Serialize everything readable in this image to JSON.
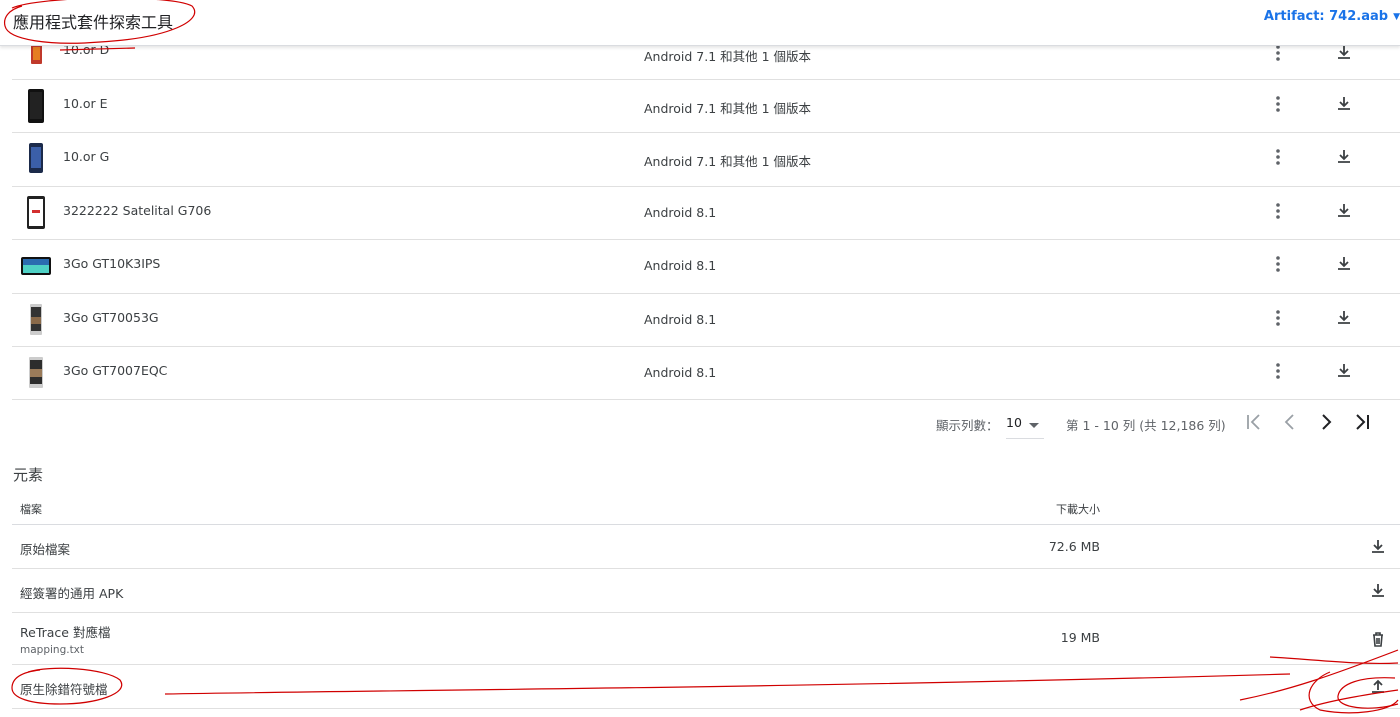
{
  "header": {
    "title": "應用程式套件探索工具",
    "artifact_label": "Artifact: 742.aab",
    "accent_color": "#1a73e8"
  },
  "devices": [
    {
      "name": "10.or D",
      "version": "Android 7.1 和其他 1 個版本",
      "thumb": "phone-orange"
    },
    {
      "name": "10.or E",
      "version": "Android 7.1 和其他 1 個版本",
      "thumb": "phone-black"
    },
    {
      "name": "10.or G",
      "version": "Android 7.1 和其他 1 個版本",
      "thumb": "phone-blue"
    },
    {
      "name": "3222222 Satelital G706",
      "version": "Android 8.1",
      "thumb": "phone-white-red"
    },
    {
      "name": "3Go GT10K3IPS",
      "version": "Android 8.1",
      "thumb": "tablet"
    },
    {
      "name": "3Go GT70053G",
      "version": "Android 8.1",
      "thumb": "phone-gray"
    },
    {
      "name": "3Go GT7007EQC",
      "version": "Android 8.1",
      "thumb": "phone-gray"
    }
  ],
  "pagination": {
    "rows_label": "顯示列數：",
    "rows_value": "10",
    "range_text": "第 1 - 10 列 (共 12,186 列)"
  },
  "elements": {
    "title": "元素",
    "col_file": "檔案",
    "col_size": "下載大小",
    "rows": [
      {
        "name": "原始檔案",
        "sub": "",
        "size": "72.6 MB",
        "action": "download-icon"
      },
      {
        "name": "經簽署的通用 APK",
        "sub": "",
        "size": "",
        "action": "download-icon"
      },
      {
        "name": "ReTrace 對應檔",
        "sub": "mapping.txt",
        "size": "19 MB",
        "action": "delete-icon"
      },
      {
        "name": "原生除錯符號檔",
        "sub": "",
        "size": "",
        "action": "upload-icon"
      }
    ]
  },
  "annotation_color": "#d00000"
}
